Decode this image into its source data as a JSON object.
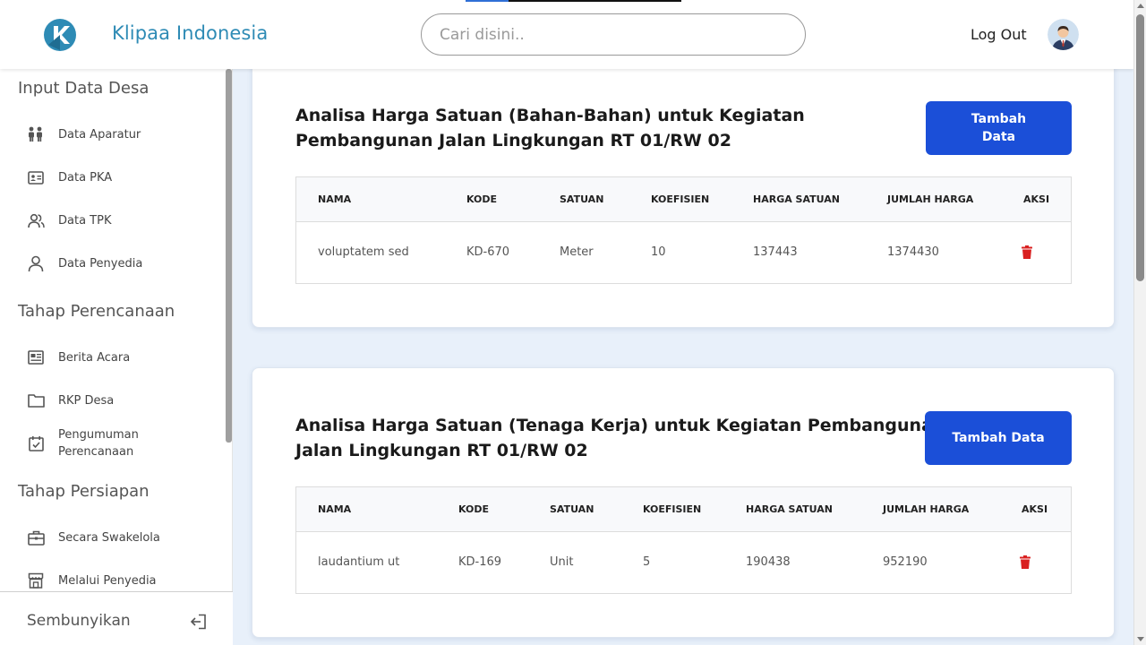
{
  "header": {
    "brand": "Klipaa Indonesia",
    "search_placeholder": "Cari disini..",
    "logout_label": "Log Out"
  },
  "sidebar": {
    "sections": [
      {
        "title": "Input Data Desa",
        "items": [
          {
            "label": "Data Aparatur",
            "icon": "people-icon"
          },
          {
            "label": "Data PKA",
            "icon": "id-card-icon"
          },
          {
            "label": "Data TPK",
            "icon": "users-icon"
          },
          {
            "label": "Data Penyedia",
            "icon": "user-icon"
          }
        ]
      },
      {
        "title": "Tahap Perencanaan",
        "items": [
          {
            "label": "Berita Acara",
            "icon": "newspaper-icon"
          },
          {
            "label": "RKP Desa",
            "icon": "folder-icon"
          },
          {
            "label": "Pengumuman Perencanaan",
            "icon": "calendar-check-icon"
          }
        ]
      },
      {
        "title": "Tahap Persiapan",
        "items": [
          {
            "label": "Secara Swakelola",
            "icon": "briefcase-icon"
          },
          {
            "label": "Melalui Penyedia",
            "icon": "store-icon"
          }
        ]
      }
    ],
    "footer_label": "Sembunyikan"
  },
  "cards": [
    {
      "title_line1": "Analisa Harga Satuan (Bahan-Bahan) untuk Kegiatan",
      "title_line2": "Pembangunan Jalan Lingkungan RT 01/RW 02",
      "add_button": "Tambah Data",
      "columns": [
        "NAMA",
        "KODE",
        "SATUAN",
        "KOEFISIEN",
        "HARGA SATUAN",
        "JUMLAH HARGA",
        "AKSI"
      ],
      "rows": [
        {
          "nama": "voluptatem sed",
          "kode": "KD-670",
          "satuan": "Meter",
          "koefisien": "10",
          "harga_satuan": "137443",
          "jumlah_harga": "1374430"
        }
      ]
    },
    {
      "title_line1": "Analisa Harga Satuan (Tenaga Kerja) untuk Kegiatan Pembangunan",
      "title_line2": "Jalan Lingkungan RT 01/RW 02",
      "add_button": "Tambah Data",
      "columns": [
        "NAMA",
        "KODE",
        "SATUAN",
        "KOEFISIEN",
        "HARGA SATUAN",
        "JUMLAH HARGA",
        "AKSI"
      ],
      "rows": [
        {
          "nama": "laudantium ut",
          "kode": "KD-169",
          "satuan": "Unit",
          "koefisien": "5",
          "harga_satuan": "190438",
          "jumlah_harga": "952190"
        }
      ]
    }
  ],
  "colors": {
    "brand": "#2e8bb5",
    "primary_button": "#1b4fd8",
    "delete": "#d92020",
    "background": "#e8f0fa"
  }
}
